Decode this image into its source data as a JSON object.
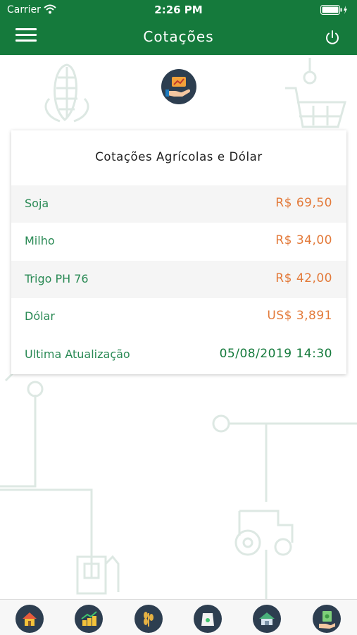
{
  "status_bar": {
    "carrier": "Carrier",
    "time": "2:26 PM"
  },
  "header": {
    "title": "Cotações"
  },
  "icons": {
    "menu": "hamburger-menu-icon",
    "power": "power-icon",
    "logo": "hand-chart-icon",
    "tabs": [
      "home-icon",
      "chart-coins-icon",
      "wheat-icon",
      "seed-bag-icon",
      "barn-icon",
      "money-hand-icon"
    ]
  },
  "colors": {
    "primary": "#157a3c",
    "price": "#e37a3a",
    "label": "#2a8a55",
    "icon_bg": "#2d3e50"
  },
  "card": {
    "title": "Cotações Agrícolas e Dólar",
    "rows": [
      {
        "label": "Soja",
        "value": "R$ 69,50"
      },
      {
        "label": "Milho",
        "value": "R$ 34,00"
      },
      {
        "label": "Trigo PH 76",
        "value": "R$ 42,00"
      },
      {
        "label": "Dólar",
        "value": "US$ 3,891"
      },
      {
        "label": "Ultima Atualização",
        "value": "05/08/2019 14:30"
      }
    ]
  }
}
